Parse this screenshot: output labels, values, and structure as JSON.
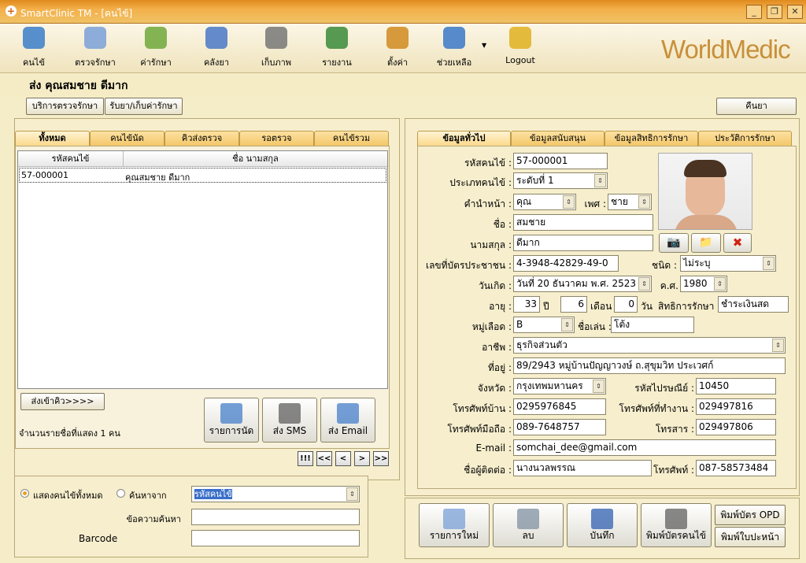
{
  "window": {
    "title": "SmartClinic TM - [คนไข้]",
    "min": "_",
    "restore": "❐",
    "close": "✕"
  },
  "toolbar": [
    {
      "label": "คนไข้",
      "icon": "patient-icon",
      "color": "#3a7ec9"
    },
    {
      "label": "ตรวจรักษา",
      "icon": "doctor-icon",
      "color": "#7aa0d8"
    },
    {
      "label": "ค่ารักษา",
      "icon": "money-icon",
      "color": "#6ea83a"
    },
    {
      "label": "คลังยา",
      "icon": "pill-icon",
      "color": "#4a78c8"
    },
    {
      "label": "เก็บภาพ",
      "icon": "camera-icon",
      "color": "#777777"
    },
    {
      "label": "รายงาน",
      "icon": "chart-icon",
      "color": "#3a8a3a"
    },
    {
      "label": "ตั้งค่า",
      "icon": "tools-icon",
      "color": "#d08a20"
    },
    {
      "label": "ช่วยเหลือ",
      "icon": "help-icon",
      "color": "#3a78c8"
    },
    {
      "label": "Logout",
      "icon": "lock-icon",
      "color": "#e0b020"
    }
  ],
  "logo": "WorldMedic",
  "patient_header": "ส่ง  คุณสมชาย ดีมาก",
  "buttons": {
    "service": "บริการตรวจรักษา",
    "medicine": "รับยา/เก็บค่ารักษา",
    "cancel": "คืนยา"
  },
  "left_tabs": [
    "ทั้งหมด",
    "คนไข้นัด",
    "คิวส่งตรวจ",
    "รอตรวจ",
    "คนไข้รวม"
  ],
  "list": {
    "headers": [
      "รหัสคนไข้",
      "ชื่อ นามสกุล"
    ],
    "rows": [
      [
        "57-000001",
        "คุณสมชาย ดีมาก"
      ]
    ]
  },
  "queue_btn": "ส่งเข้าคิว>>>>",
  "count_text": "จำนวนรายชื่อที่แสดง 1 คน",
  "actions": [
    {
      "label": "รายการนัด",
      "icon": "calendar-icon"
    },
    {
      "label": "ส่ง SMS",
      "icon": "phone-icon"
    },
    {
      "label": "ส่ง Email",
      "icon": "email-icon"
    }
  ],
  "nav": [
    "!!!",
    "<<",
    "<",
    ">",
    ">>"
  ],
  "search": {
    "show_all": "แสดงคนไข้ทั้งหมด",
    "search_from": "ค้นหาจาก",
    "search_by": "รหัสคนไข้",
    "keyword_label": "ข้อความค้นหา",
    "barcode_label": "Barcode"
  },
  "right_tabs": [
    "ข้อมูลทั่วไป",
    "ข้อมูลสนับสนุน",
    "ข้อมูลสิทธิการรักษา",
    "ประวัติการรักษา"
  ],
  "form": {
    "hn_label": "รหัสคนไข้ :",
    "hn": "57-000001",
    "type_label": "ประเภทคนไข้ :",
    "type": "ระดับที่ 1",
    "prefix_label": "คำนำหน้า :",
    "prefix": "คุณ",
    "sex_label": "เพศ :",
    "sex": "ชาย",
    "fname_label": "ชื่อ :",
    "fname": "สมชาย",
    "lname_label": "นามสกุล :",
    "lname": "ดีมาก",
    "id_label": "เลขที่บัตรประชาชน :",
    "id": "4-3948-42829-49-0",
    "idtype_label": "ชนิด :",
    "idtype": "ไม่ระบุ",
    "dob_label": "วันเกิด :",
    "dob": "วันที่ 20  ธันวาคม  พ.ศ. 2523",
    "ce_label": "ค.ศ.",
    "ce": "1980",
    "age_label": "อายุ :",
    "age_y": "33",
    "y_unit": "ปี",
    "age_m": "6",
    "m_unit": "เดือน",
    "age_d": "0",
    "d_unit": "วัน",
    "right_label": "สิทธิการรักษา :",
    "right": "ชำระเงินสด",
    "blood_label": "หมู่เลือด :",
    "blood": "B",
    "nick_label": "ชื่อเล่น :",
    "nick": "โต้ง",
    "job_label": "อาชีพ :",
    "job": "ธุรกิจส่วนตัว",
    "addr_label": "ที่อยู่ :",
    "addr": "89/2943 หมู่บ้านปัญญาวงษ์ ถ.สุขุมวิท ประเวศก์",
    "prov_label": "จังหวัด :",
    "prov": "กรุงเทพมหานคร",
    "zip_label": "รหัสไปรษณีย์ :",
    "zip": "10450",
    "tel_label": "โทรศัพท์บ้าน :",
    "tel": "0295976845",
    "work_label": "โทรศัพท์ที่ทำงาน :",
    "work": "029497816",
    "mob_label": "โทรศัพท์มือถือ :",
    "mob": "089-7648757",
    "fax_label": "โทรสาร :",
    "fax": "029497806",
    "email_label": "E-mail :",
    "email": "somchai_dee@gmail.com",
    "contact_label": "ชื่อผู้ติดต่อ :",
    "contact": "นางนวลพรรณ",
    "ctel_label": "โทรศัพท์ :",
    "ctel": "087-58573484"
  },
  "bottom": [
    {
      "label": "รายการใหม่",
      "icon": "new-doc-icon"
    },
    {
      "label": "ลบ",
      "icon": "trash-icon"
    },
    {
      "label": "บันทึก",
      "icon": "save-icon"
    },
    {
      "label": "พิมพ์บัตรคนไข้",
      "icon": "printer-icon"
    }
  ],
  "print_opd": "พิมพ์บัตร OPD",
  "print_page": "พิมพ์ใบปะหน้า"
}
